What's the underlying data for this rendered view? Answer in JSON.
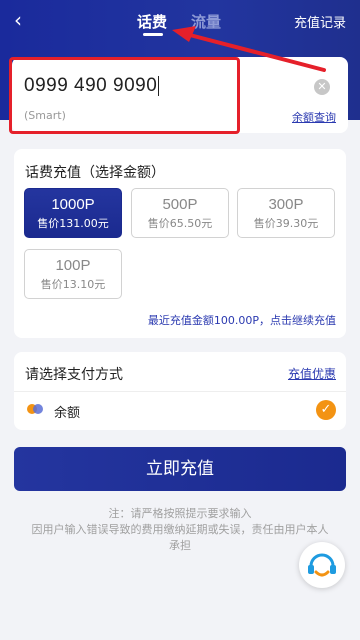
{
  "header": {
    "back_glyph": "‹",
    "tabs": [
      {
        "label": "话费",
        "active": true
      },
      {
        "label": "流量",
        "active": false
      }
    ],
    "history_link": "充值记录"
  },
  "phone": {
    "value": "0999 490 9090",
    "operator": "(Smart)",
    "balance_link": "余额查询",
    "clear_icon": "close-circle-icon"
  },
  "recharge": {
    "title": "话费充值（选择金额）",
    "options": [
      {
        "amount": "1000P",
        "price": "售价131.00元",
        "selected": true
      },
      {
        "amount": "500P",
        "price": "售价65.50元",
        "selected": false
      },
      {
        "amount": "300P",
        "price": "售价39.30元",
        "selected": false
      },
      {
        "amount": "100P",
        "price": "售价13.10元",
        "selected": false
      }
    ],
    "recent_note": "最近充值金额100.00P，点击继续充值"
  },
  "payment": {
    "title": "请选择支付方式",
    "promo_link": "充值优惠",
    "method_label": "余额",
    "method_selected": true
  },
  "submit_label": "立即充值",
  "notice": {
    "line1": "注：请严格按照提示要求输入",
    "line2": "因用户输入错误导致的费用缴纳延期或失误，责任由用户本人承担"
  },
  "colors": {
    "brand": "#1f2f9a",
    "accent": "#f39313",
    "annotation_red": "#e5202a"
  }
}
